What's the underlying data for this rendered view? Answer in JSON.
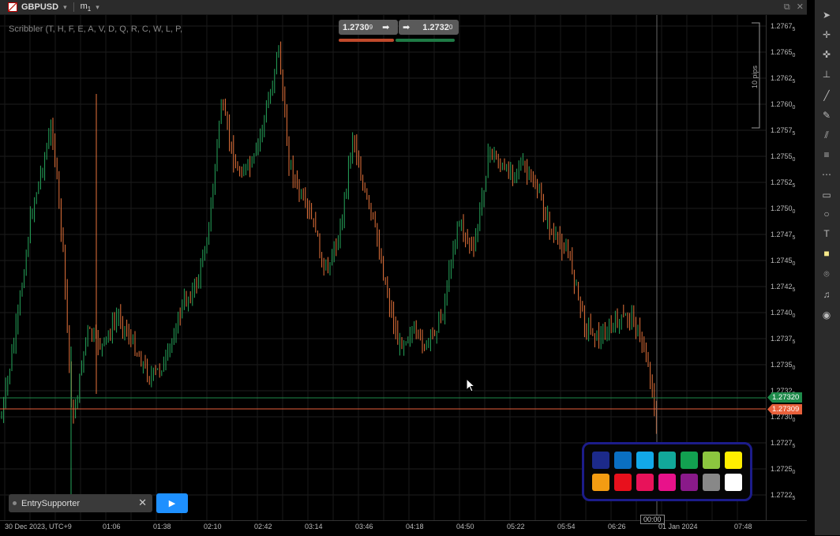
{
  "header": {
    "symbol": "GBPUSD",
    "timeframe": "m",
    "timeframe_sub": "1",
    "caret": "▾"
  },
  "window_icons": [
    "⧉",
    "✕"
  ],
  "chart": {
    "indicator_label": "Scribbler (T, H, F, E, A, V, D, Q, R, C, W, L, P,",
    "sell_price": "1.2730",
    "sell_price_sup": "9",
    "buy_price": "1.2732",
    "buy_price_sup": "0",
    "pips_label": "10 pips",
    "bid_tag": "1.27320",
    "ask_tag": "1.27309",
    "cursor_time": "00:00",
    "colors": {
      "bull": "#26a65b",
      "bear": "#e8743b",
      "bid_line": "#1e8a4a",
      "ask_line": "#e8603b"
    }
  },
  "price_ticks": [
    "1.2767",
    "1.2765",
    "1.2762",
    "1.2760",
    "1.2757",
    "1.2755",
    "1.2752",
    "1.2750",
    "1.2747",
    "1.2745",
    "1.2742",
    "1.2740",
    "1.2737",
    "1.2735",
    "1.2732",
    "1.2730",
    "1.2727",
    "1.2725",
    "1.2722"
  ],
  "price_ticks_sub": [
    "5",
    "0",
    "5",
    "0",
    "5",
    "0",
    "5",
    "0",
    "5",
    "0",
    "5",
    "0",
    "5",
    "0",
    "5",
    "0",
    "5",
    "0",
    "5"
  ],
  "time_ticks": [
    "30 Dec 2023, UTC+9",
    "01:06",
    "01:38",
    "02:10",
    "02:42",
    "03:14",
    "03:46",
    "04:18",
    "04:50",
    "05:22",
    "05:54",
    "06:26",
    "01 Jan 2024",
    "07:48"
  ],
  "entry_panel": {
    "label": "EntrySupporter",
    "close": "✕",
    "play": "▶"
  },
  "palette": {
    "row1": [
      "#1c2a8a",
      "#0a6fc2",
      "#12a8e8",
      "#12a89a",
      "#12a050",
      "#8cc63f",
      "#ffee00"
    ],
    "row2": [
      "#f39c12",
      "#e8101c",
      "#e8125a",
      "#e8128a",
      "#8a1a8a",
      "#888888",
      "#ffffff"
    ]
  }
}
